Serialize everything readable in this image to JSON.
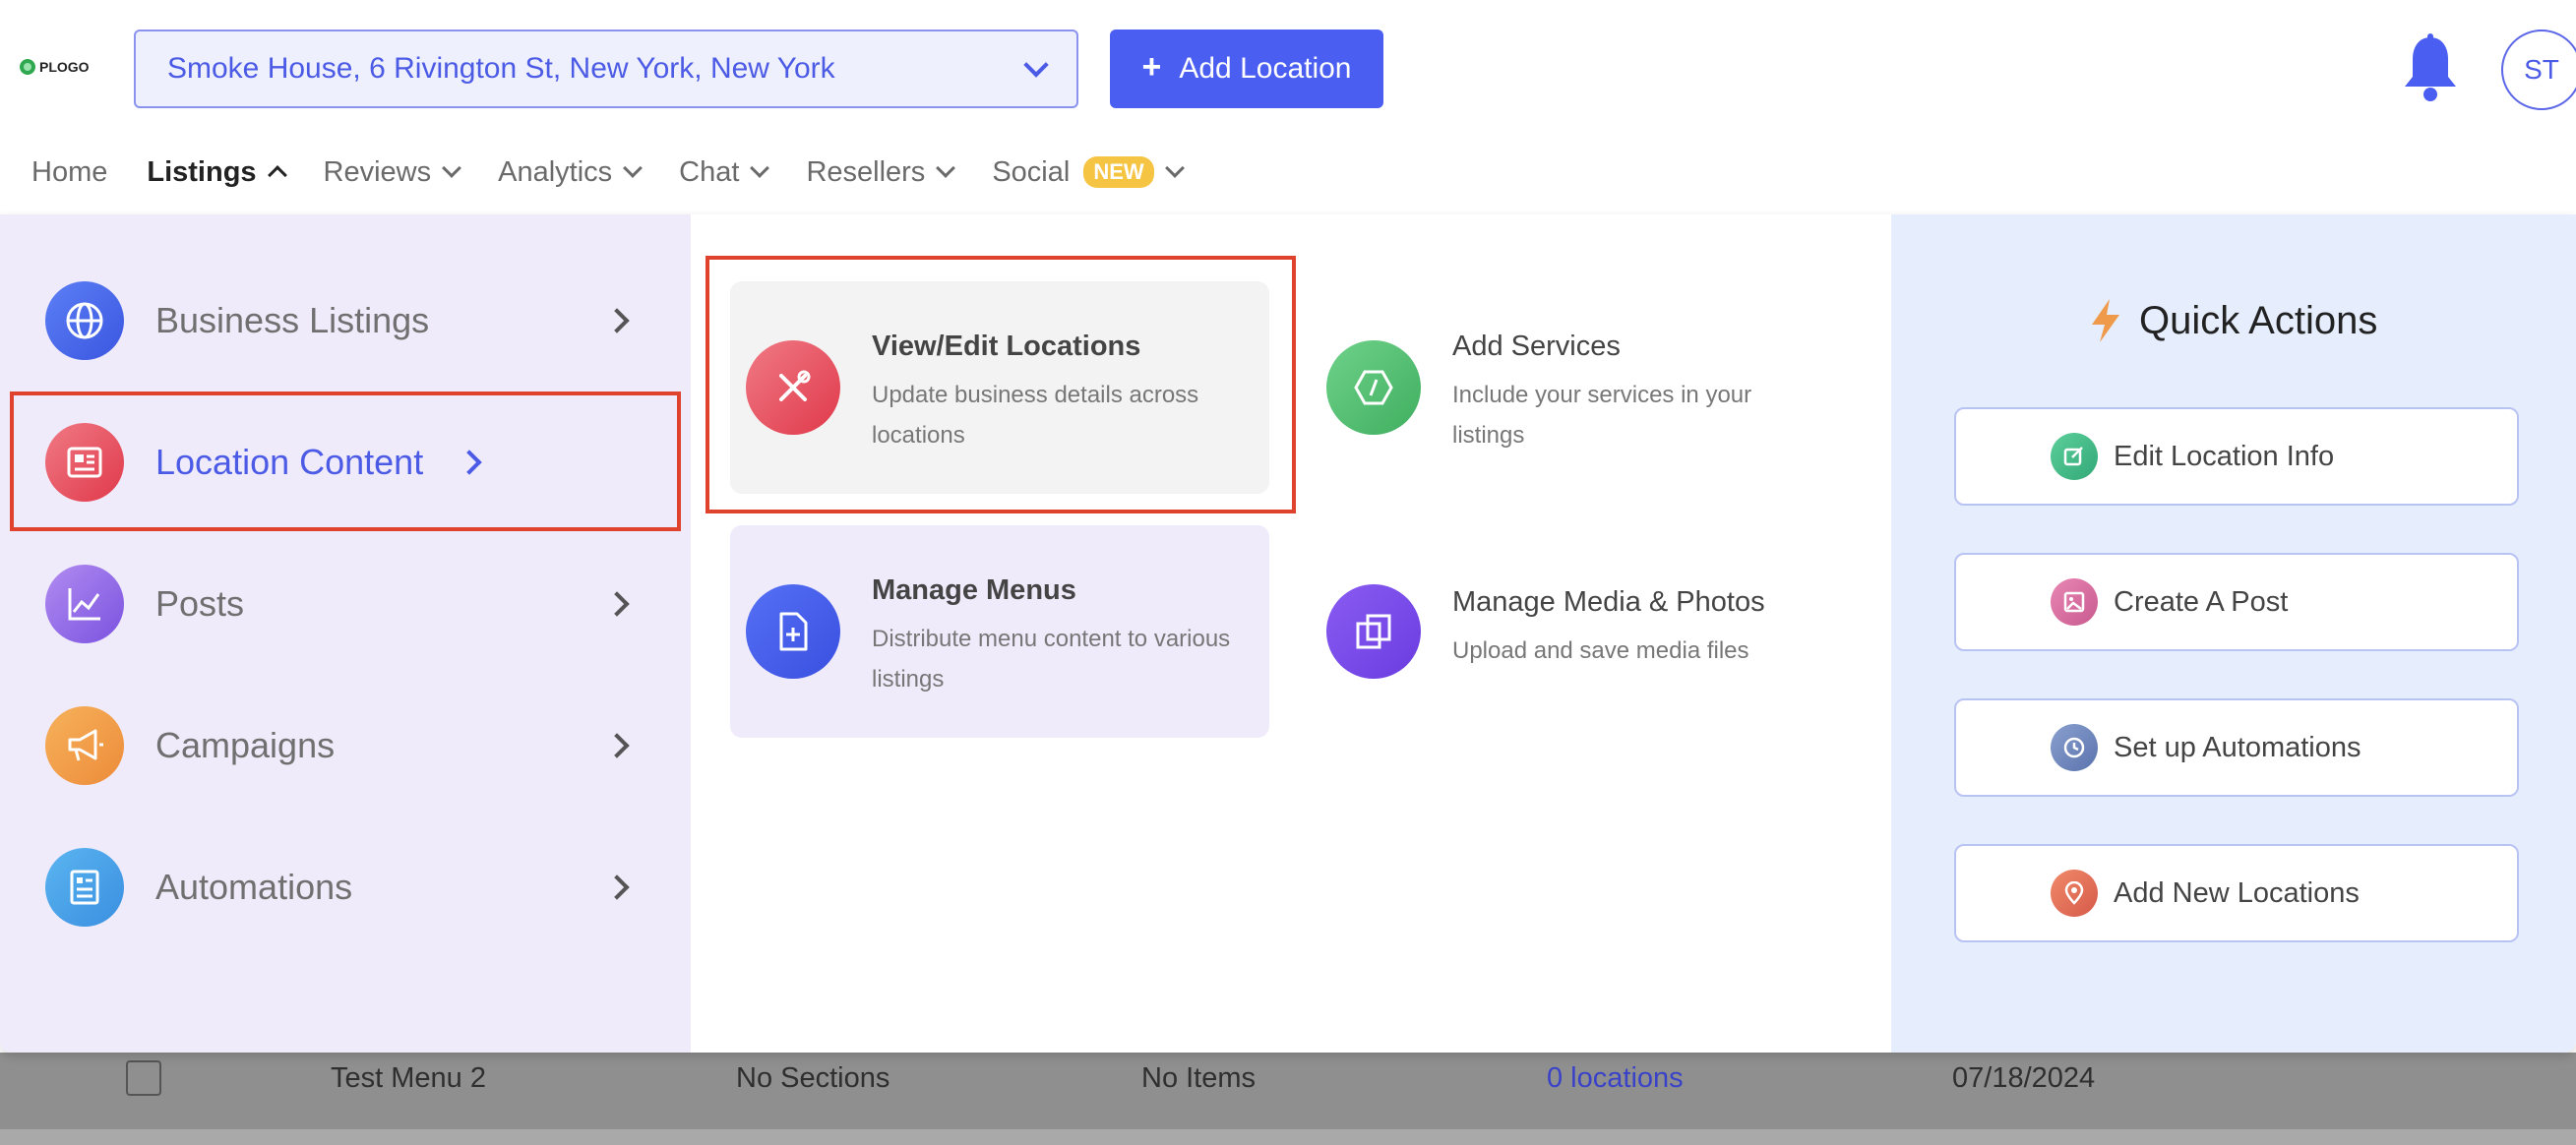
{
  "header": {
    "logo_text": "PLOGO",
    "location_value": "Smoke House, 6 Rivington St, New York, New York",
    "add_location_label": "Add Location",
    "add_location_icon": "plus-icon",
    "avatar_initials": "ST"
  },
  "nav": {
    "items": [
      {
        "label": "Home"
      },
      {
        "label": "Listings"
      },
      {
        "label": "Reviews"
      },
      {
        "label": "Analytics"
      },
      {
        "label": "Chat"
      },
      {
        "label": "Resellers"
      },
      {
        "label": "Social"
      }
    ],
    "social_badge": "NEW"
  },
  "sidebar": {
    "items": [
      {
        "label": "Business Listings",
        "icon": "globe-icon"
      },
      {
        "label": "Location Content",
        "icon": "document-icon"
      },
      {
        "label": "Posts",
        "icon": "chart-icon"
      },
      {
        "label": "Campaigns",
        "icon": "megaphone-icon"
      },
      {
        "label": "Automations",
        "icon": "form-icon"
      }
    ]
  },
  "cards": [
    {
      "title": "View/Edit Locations",
      "desc": "Update business details across locations",
      "icon": "tools-icon"
    },
    {
      "title": "Add Services",
      "desc": "Include your services in your listings",
      "icon": "hexagon-icon"
    },
    {
      "title": "Manage Menus",
      "desc": "Distribute menu content to various listings",
      "icon": "file-plus-icon"
    },
    {
      "title": "Manage Media & Photos",
      "desc": "Upload and save media files",
      "icon": "copy-icon"
    }
  ],
  "quick_actions": {
    "title": "Quick Actions",
    "items": [
      {
        "label": "Edit Location Info",
        "icon": "edit-icon"
      },
      {
        "label": "Create A Post",
        "icon": "image-icon"
      },
      {
        "label": "Set up Automations",
        "icon": "clock-icon"
      },
      {
        "label": "Add New Locations",
        "icon": "pin-icon"
      }
    ]
  },
  "table": {
    "row": {
      "name": "Test Menu 2",
      "sections": "No Sections",
      "items": "No Items",
      "locations": "0 locations",
      "date": "07/18/2024"
    }
  },
  "colors": {
    "accent": "#4b5ef2",
    "highlight": "#e0432d",
    "sidebar_bg": "#efebfb",
    "quick_actions_bg": "#e6eefd"
  }
}
